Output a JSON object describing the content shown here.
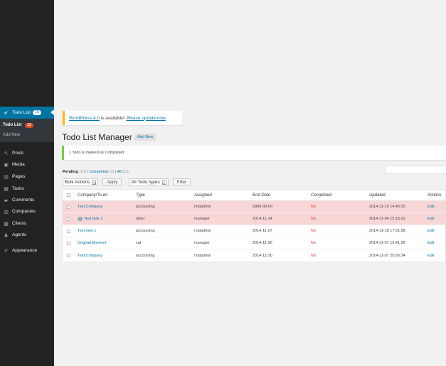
{
  "sidebar": {
    "current_item": {
      "label": "Todo List",
      "badge": "18"
    },
    "submenu": {
      "todo_list": "Todo List",
      "todo_badge": "11",
      "add_new": "Add New"
    },
    "items": [
      {
        "label": "Posts",
        "icon": "pin-icon"
      },
      {
        "label": "Media",
        "icon": "media-icon"
      },
      {
        "label": "Pages",
        "icon": "pages-icon"
      },
      {
        "label": "Tasks",
        "icon": "tasks-icon"
      },
      {
        "label": "Comments",
        "icon": "comments-icon"
      },
      {
        "label": "Companies",
        "icon": "companies-icon"
      },
      {
        "label": "Clients",
        "icon": "clients-icon"
      },
      {
        "label": "Agents",
        "icon": "agents-icon"
      },
      {
        "label": "Appearance",
        "icon": "appearance-icon"
      }
    ]
  },
  "notices": {
    "update_link": "WordPress 4.0",
    "update_text": " is available! ",
    "update_now": "Please update now",
    "update_end": ".",
    "success": "1 Todo is marked as Completed"
  },
  "page": {
    "title": "Todo List Manager",
    "add_new": "Add New"
  },
  "views": {
    "pending": "Pending",
    "pending_count": "(10)",
    "completed": "Completed",
    "completed_count": "(2)",
    "all": "All",
    "all_count": "(12)"
  },
  "tablenav": {
    "bulk_actions": "Bulk Actions",
    "apply": "Apply",
    "type_filter": "All Todo types",
    "filter": "Filter"
  },
  "table": {
    "columns": [
      "Company/To-do",
      "Type",
      "Assigned",
      "End Date",
      "Completed",
      "Updated",
      "Actions"
    ],
    "rows": [
      {
        "company": "Test Company",
        "type": "accounting",
        "assigned": "midadmin",
        "end_date": "0000-00-00",
        "completed": "No",
        "updated": "2014-11-19 14:45:25",
        "action": "Edit",
        "overdue": true
      },
      {
        "company": "Test task 1",
        "type": "other",
        "assigned": "manager",
        "end_date": "2014-11-14",
        "completed": "No",
        "updated": "2014-11-04 15:16:22",
        "action": "Edit",
        "overdue": true
      },
      {
        "company": "Test new 1",
        "type": "accounting",
        "assigned": "midadmin",
        "end_date": "2014-11-27",
        "completed": "No",
        "updated": "2014-11-18 17:01:58",
        "action": "Edit",
        "overdue": false
      },
      {
        "company": "Original Element",
        "type": "vat",
        "assigned": "manager",
        "end_date": "2014-11-30",
        "completed": "No",
        "updated": "2014-11-07 15:41:28",
        "action": "Edit",
        "overdue": false
      },
      {
        "company": "Test Company",
        "type": "accounting",
        "assigned": "midadmin",
        "end_date": "2014-11-30",
        "completed": "No",
        "updated": "2014-11-07 20:26:34",
        "action": "Edit",
        "overdue": false
      }
    ]
  },
  "colors": {
    "sidebar": "#222222",
    "accent": "#0074a2",
    "overdue": "#f9d6d6",
    "no": "#dd3d36"
  }
}
